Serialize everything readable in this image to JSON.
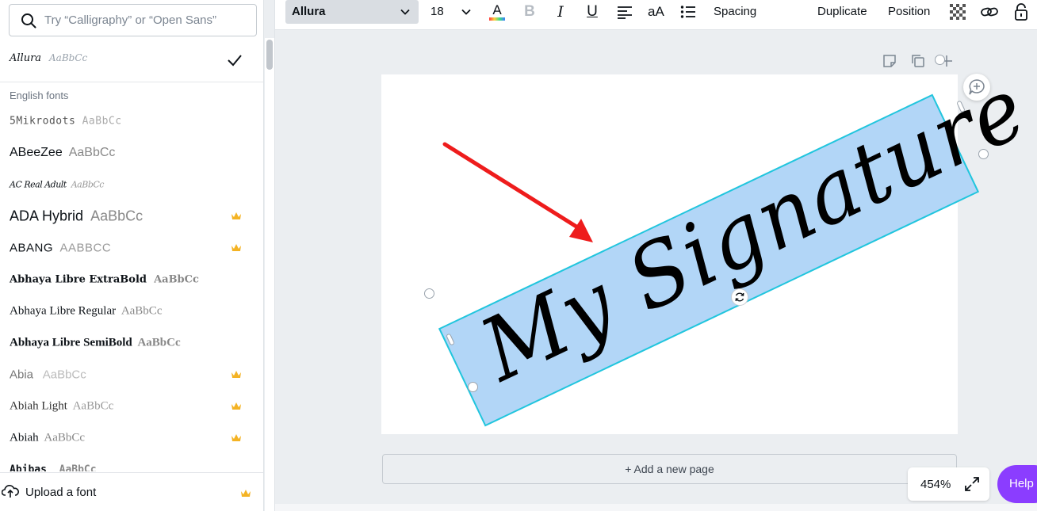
{
  "search": {
    "placeholder": "Try “Calligraphy” or “Open Sans”"
  },
  "current_font": {
    "name": "Allura",
    "sample": "AaBbCc"
  },
  "section_title": "English fonts",
  "fonts": [
    {
      "name": "5Mikrodots",
      "sample": "AaBbCc",
      "premium": false
    },
    {
      "name": "ABeeZee",
      "sample": "AaBbCc",
      "premium": false
    },
    {
      "name": "AC Real Adult",
      "sample": "AaBbCc",
      "premium": false
    },
    {
      "name": "ADA Hybrid",
      "sample": "AaBbCc",
      "premium": true
    },
    {
      "name": "ABANG",
      "sample": "AABBCC",
      "premium": true
    },
    {
      "name": "Abhaya Libre ExtraBold",
      "sample": "AaBbCc",
      "premium": false
    },
    {
      "name": "Abhaya Libre Regular",
      "sample": "AaBbCc",
      "premium": false
    },
    {
      "name": "Abhaya Libre SemiBold",
      "sample": "AaBbCc",
      "premium": false
    },
    {
      "name": "Abia",
      "sample": "AaBbCc",
      "premium": true
    },
    {
      "name": "Abiah Light",
      "sample": "AaBbCc",
      "premium": true
    },
    {
      "name": "Abiah",
      "sample": "AaBbCc",
      "premium": true
    },
    {
      "name": "Abibas",
      "sample": "AaBbCc",
      "premium": false
    }
  ],
  "upload_font": {
    "label": "Upload a font"
  },
  "toolbar": {
    "font_family": "Allura",
    "font_size": "18",
    "spacing_label": "Spacing",
    "duplicate_label": "Duplicate",
    "position_label": "Position",
    "case_label": "aA"
  },
  "canvas": {
    "text": "My Signature",
    "add_page_label": "+ Add a new page"
  },
  "zoom": {
    "value": "454%"
  },
  "help": {
    "label": "Help"
  },
  "colors": {
    "selection": "#21c6dd",
    "highlight": "#b2d6f7",
    "arrow": "#ee1c1c",
    "crown": "#f4b324",
    "help": "#8b3dff"
  },
  "icons": {
    "search": "search-icon",
    "check": "checkmark-icon",
    "crown": "crown-icon",
    "upload": "cloud-upload-icon",
    "chevron": "chevron-down-icon",
    "text_color": "text-color-icon",
    "bold": "bold-icon",
    "italic": "italic-icon",
    "underline": "underline-icon",
    "align": "align-left-icon",
    "list": "list-icon",
    "transparency": "transparency-icon",
    "link": "link-icon",
    "lock": "lock-icon",
    "expand": "expand-icon",
    "rotate": "rotate-icon",
    "comment": "add-comment-icon"
  }
}
